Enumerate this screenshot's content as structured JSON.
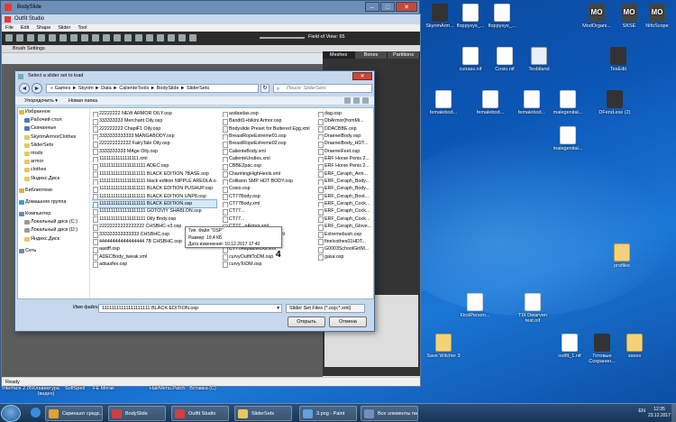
{
  "desktop": {
    "icons": [
      {
        "label": "SkyrimArm...",
        "kind": "app"
      },
      {
        "label": "floppysys_...",
        "kind": "doc"
      },
      {
        "label": "floppysys_...",
        "kind": "doc"
      },
      {
        "label": "ModOrgani...",
        "kind": "mo"
      },
      {
        "label": "SKSE",
        "kind": "mo"
      },
      {
        "label": "NifoScope",
        "kind": "mo"
      },
      {
        "label": "cuirass.nif",
        "kind": "doc"
      },
      {
        "label": "Cosio.nif",
        "kind": "doc"
      },
      {
        "label": "Tesblland",
        "kind": "ex"
      },
      {
        "label": "TesEdit",
        "kind": "app"
      },
      {
        "label": "femalebod...",
        "kind": "doc"
      },
      {
        "label": "femalebod...",
        "kind": "doc"
      },
      {
        "label": "femalebod...",
        "kind": "doc"
      },
      {
        "label": "malegenital...",
        "kind": "doc"
      },
      {
        "label": "DFend.exe (2)",
        "kind": "app"
      },
      {
        "label": "malegenital...",
        "kind": "doc"
      },
      {
        "label": "profiles",
        "kind": "fol"
      },
      {
        "label": "FirstPerson...",
        "kind": "doc"
      },
      {
        "label": "TIX Dwarven test.nif",
        "kind": "doc"
      },
      {
        "label": "Save Witcher 3",
        "kind": "fol"
      },
      {
        "label": "outfit_1.nif",
        "kind": "doc"
      },
      {
        "label": "Готовые Сохранен...",
        "kind": "app"
      },
      {
        "label": "saves",
        "kind": "fol"
      }
    ],
    "bottom_icons": [
      {
        "label": "Interface 2.05"
      },
      {
        "label": "Клавиатура (видео)"
      },
      {
        "label": "SoftSpell"
      },
      {
        "label": "FE Mirrak"
      },
      {
        "label": "HairMenu.Patch"
      },
      {
        "label": "Вставка (С)"
      }
    ]
  },
  "bodyslide": {
    "title": "BodySlide",
    "accent": "#6d8fb5"
  },
  "outfit_studio": {
    "title": "Outfit Studio",
    "menu": [
      "File",
      "Edit",
      "Shape",
      "Slider",
      "Tool"
    ],
    "fov_label": "Field of View: 65",
    "brush_settings": "Brush Settings",
    "tabs": [
      "Meshes",
      "Bones",
      "Partitions"
    ],
    "status": "Ready"
  },
  "dialog": {
    "title": "Select a slider set to load",
    "path": "«  Games  ►  Skyrim  ►  Data  ►  CalienteTools  ►  BodySlide  ►  SliderSets",
    "search_placeholder": "Поиск: SliderSets",
    "organize": "Упорядочить ▾",
    "new_folder": "Новая папка",
    "nav": [
      {
        "label": "Избранное",
        "h": true,
        "color": "#e8b830"
      },
      {
        "label": "Рабочий стол",
        "color": "#4a7ab8"
      },
      {
        "label": "Скачанные",
        "color": "#4a7ab8"
      },
      {
        "label": "SkyrimArmorClothes",
        "color": "#e8c860"
      },
      {
        "label": "SliderSets",
        "color": "#e8c860"
      },
      {
        "label": "mods",
        "color": "#e8c860"
      },
      {
        "label": "armor",
        "color": "#e8c860"
      },
      {
        "label": "clothes",
        "color": "#e8c860"
      },
      {
        "label": "Яндекс.Диск",
        "color": "#e8c860"
      },
      {
        "label": "",
        "sp": true
      },
      {
        "label": "Библиотеки",
        "h": true,
        "color": "#d8b050"
      },
      {
        "label": "",
        "sp": true
      },
      {
        "label": "Домашняя группа",
        "h": true,
        "color": "#3a9ad8"
      },
      {
        "label": "",
        "sp": true
      },
      {
        "label": "Компьютер",
        "h": true,
        "color": "#6a8ab0"
      },
      {
        "label": "Локальный диск (C:)",
        "color": "#999"
      },
      {
        "label": "Локальный диск (D:)",
        "color": "#999"
      },
      {
        "label": "Яндекс.Диск",
        "color": "#e8c860"
      },
      {
        "label": "",
        "sp": true
      },
      {
        "label": "Сеть",
        "h": true,
        "color": "#6a8ab0"
      }
    ],
    "col1": [
      "22222222 NEW ARMOR OILY.osp",
      "333333333 Merchant Oily.osp",
      "222222222 ChapiF1 Oily.osp",
      "3333333333333 MANGABODY.osp",
      "222222222222 FairyTale Oily.osp",
      "3333333333 MAge Oily.osp",
      "11111111111111111.xml",
      "11111111111111111111 ADEC.osp",
      "11111111111111111111 BLACK EDITION 7BASE.osp",
      "11111111111111111111 black edition NIPPLE AREOLA.osp",
      "11111111111111111111 BLACK EDITION PUSHUP.osp",
      "11111111111111111111 BLACK EDITION UNP8.osp",
      "11111111111111111111 BLACK EDITION.osp",
      "11111111111111111111 GOTOVIY SHABLON.osp",
      "11111111111111111111 Oily Body.osp",
      "22222222222222222 CHSBHC-v3.osp",
      "333333333333333 CHSBHC.osp",
      "44444444444444444 7B CHSBHC.osp",
      "aastff.osp",
      "ADECBody_tweak.xml",
      "adsasfes.osp"
    ],
    "col2": [
      "asdasdas.osp",
      "Bandit1+bikini Armor.osp",
      "Bodyslide Preset for Buttered Egg.xml",
      "BreastRopeExtreme01.osp",
      "BreastRopeExtreme02.osp",
      "CalienteBody.xml",
      "CalienteUndies.xml",
      "CBBE2pac.osp",
      "CharmingHighHeels.xml",
      "Collision SMP HDT BODY.osp",
      "Cosio.osp",
      "CT77Body.osp",
      "CT77Body.xml",
      "CT77...",
      "CT77...",
      "CT77...nArmor.xml",
      "CT77ReplacerClothes.xml",
      "CT77ReplacerDB.xml",
      "CT77ReplacerDG.xml",
      "curvyOutfitToDM.osp",
      "curvyToDM.osp"
    ],
    "col3": [
      "dag.osp",
      "DbArmor(fromMi...",
      "DDACBBE.osp",
      "DraeneiBody.osp",
      "DraeneiBody_HDT...",
      "DraeneiFeet.osp",
      "ERF Horse Penis 2...",
      "ERF Horse Penis 2...",
      "ERF_Ceraph_Arm...",
      "ERF_Ceraph_Body...",
      "ERF_Ceraph_Body...",
      "ERF_Ceraph_Boot...",
      "ERF_Ceraph_Cock...",
      "ERF_Ceraph_Cock...",
      "ERF_Ceraph_Cock...",
      "ERF_Ceraph_Glove...",
      "Extremebush.osp",
      "finelcothes01HDT...",
      "G0003SchoolGirlM...",
      "gasa.osp",
      ""
    ],
    "selected_index": 12,
    "tooltip": {
      "type": "Тип: Файл \"OSP\"",
      "size": "Размер: 19,4 КБ",
      "date": "Дата изменения: 10.12.2017 17:40"
    },
    "annotation": "4",
    "filename_label": "Имя файла:",
    "filename_value": "11111111111111111111 BLACK EDITION.osp",
    "filetype": "Slider Set Files (*.osp;*.xml)",
    "open": "Открыть",
    "cancel": "Отмена"
  },
  "taskbar": {
    "items": [
      {
        "label": "Скриншот средс...",
        "color": "#e8a030"
      },
      {
        "label": "BodySlide",
        "color": "#d04040"
      },
      {
        "label": "Outfit Studio",
        "color": "#d04040"
      },
      {
        "label": "SliderSets",
        "color": "#e8c860"
      },
      {
        "label": "3.png - Paint",
        "color": "#60a0e0"
      },
      {
        "label": "Все элементы па...",
        "color": "#7090c0"
      }
    ],
    "lang": "EN",
    "time": "12:35",
    "date": "23.12.2017"
  }
}
